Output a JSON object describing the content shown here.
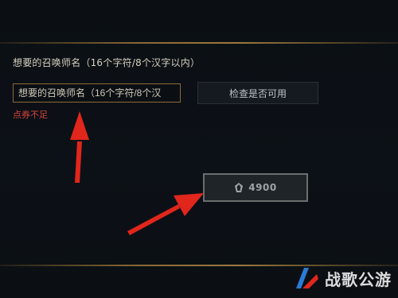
{
  "form": {
    "section_title": "想要的召唤师名（16个字符/8个汉字以内）",
    "name_input_placeholder": "想要的召唤师名（16个字符/8个汉",
    "error_message": "点券不足",
    "check_button_label": "检查是否可用"
  },
  "purchase": {
    "price": "4900",
    "currency_icon": "rp-coin-icon"
  },
  "annotations": {
    "arrow_color": "#e1261c",
    "arrow_icons": [
      "red-arrow-up-icon",
      "red-arrow-right-icon"
    ]
  },
  "watermark": {
    "brand_text": "战歌公游",
    "logo_icon": "brand-logo-icon"
  },
  "colors": {
    "background": "#0b0f14",
    "gold_accent": "#8a6a34",
    "error": "#d9443b",
    "button_disabled": "#1f2428"
  }
}
